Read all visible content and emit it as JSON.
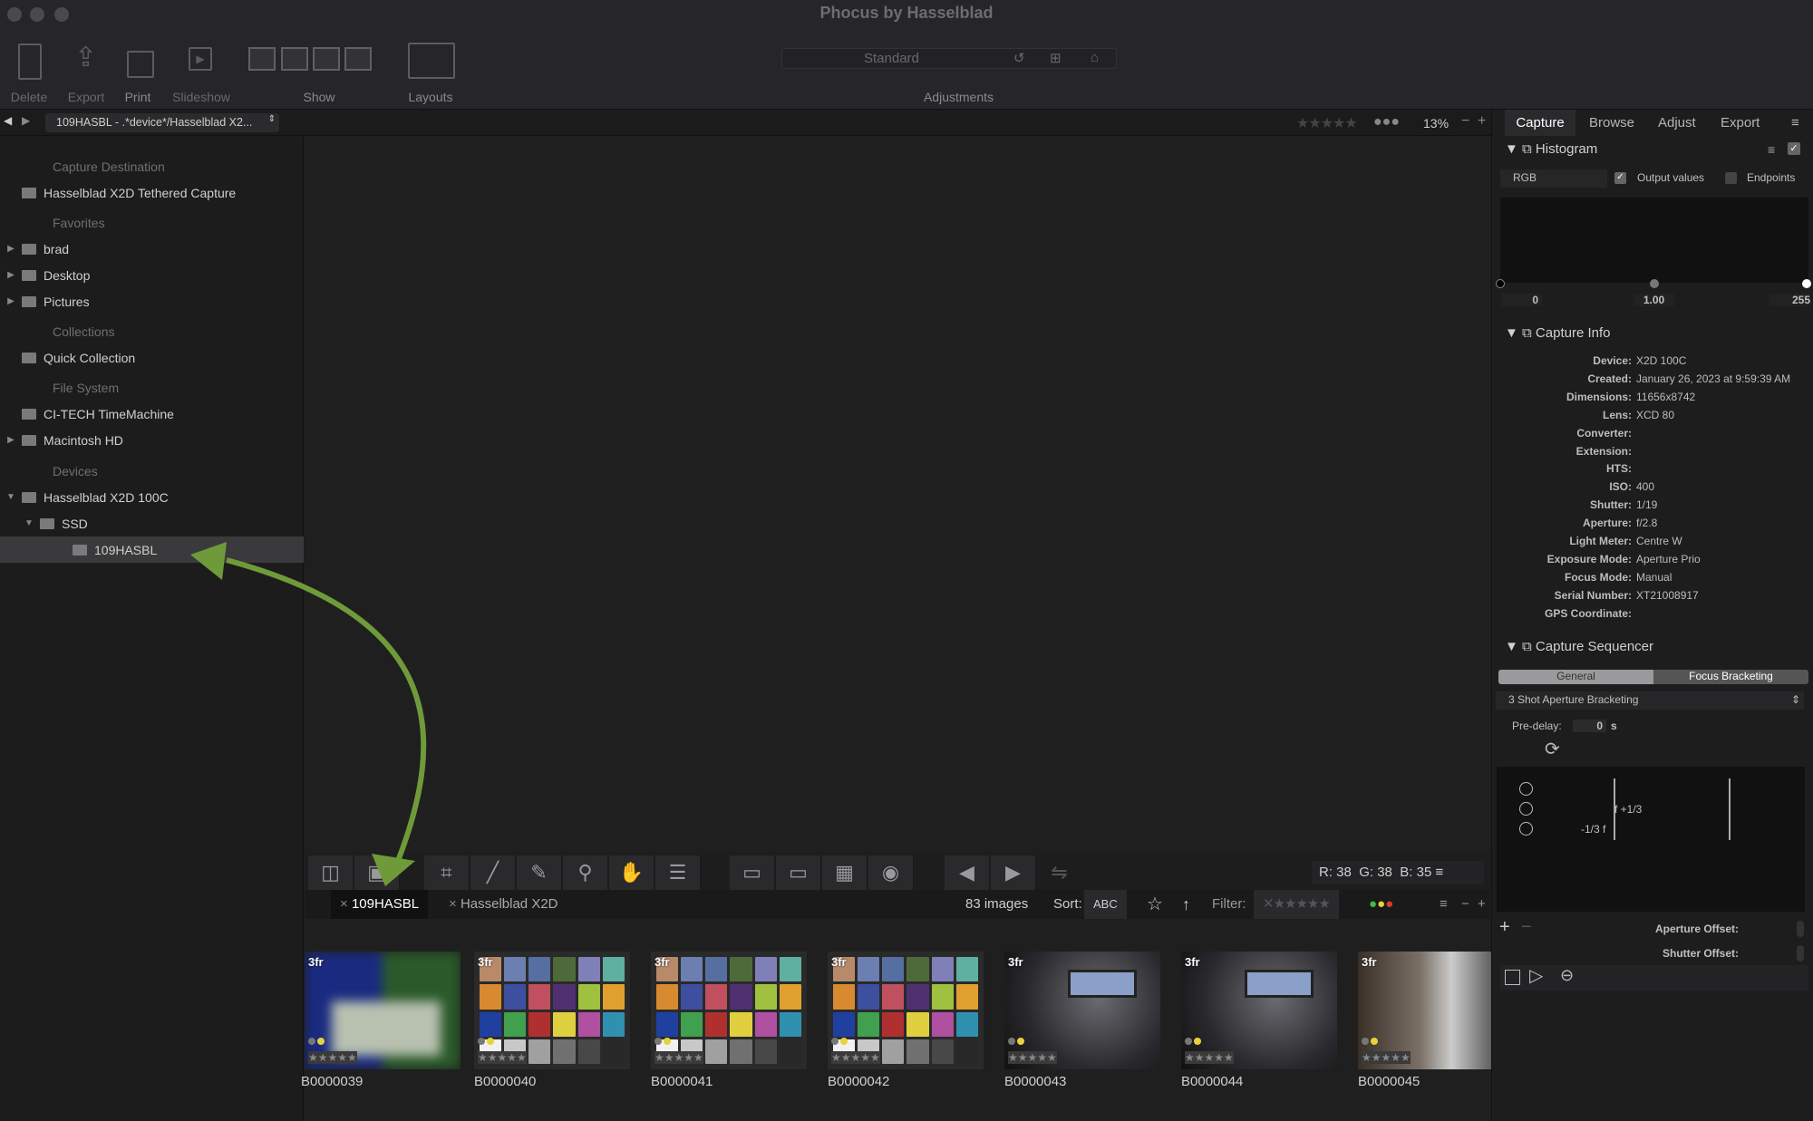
{
  "window": {
    "title": "Phocus by Hasselblad"
  },
  "toolbar": {
    "items": [
      {
        "label": "Delete",
        "icon": "trash-icon"
      },
      {
        "label": "Export",
        "icon": "export-icon"
      },
      {
        "label": "Print",
        "icon": "print-icon"
      },
      {
        "label": "Slideshow",
        "icon": "slideshow-icon"
      },
      {
        "label": "Show",
        "icon": "show-layout-icon"
      },
      {
        "label": "Layouts",
        "icon": "layouts-icon"
      }
    ],
    "preset": "Standard",
    "adjustments_label": "Adjustments"
  },
  "nav": {
    "path": "109HASBL - .*device*/Hasselblad X2...",
    "zoom": "13%",
    "tabs": [
      "Capture",
      "Browse",
      "Adjust",
      "Export"
    ],
    "active_tab": "Capture"
  },
  "sidebar": {
    "capture_destination": {
      "heading": "Capture Destination",
      "items": [
        "Hasselblad X2D Tethered Capture"
      ]
    },
    "favorites": {
      "heading": "Favorites",
      "items": [
        "brad",
        "Desktop",
        "Pictures"
      ]
    },
    "collections": {
      "heading": "Collections",
      "items": [
        "Quick Collection"
      ]
    },
    "file_system": {
      "heading": "File System",
      "items": [
        "CI-TECH TimeMachine",
        "Macintosh HD"
      ]
    },
    "devices": {
      "heading": "Devices",
      "items": [
        "Hasselblad X2D 100C",
        "SSD",
        "109HASBL"
      ],
      "selected": "109HASBL"
    }
  },
  "viewer": {
    "readout": {
      "r_label": "R:",
      "r": "38",
      "g_label": "G:",
      "g": "38",
      "b_label": "B:",
      "b": "35"
    }
  },
  "browser": {
    "tabs": [
      "109HASBL",
      "Hasselblad X2D"
    ],
    "active_tab": "109HASBL",
    "count": "83 images",
    "sort_label": "Sort:",
    "sort_value": "ABC",
    "filter_label": "Filter:",
    "filter_colors": [
      "#3fbf3f",
      "#e6d23a",
      "#e03a2f"
    ]
  },
  "thumbnails": [
    {
      "name": "B0000039",
      "badge": "3fr"
    },
    {
      "name": "B0000040",
      "badge": "3fr"
    },
    {
      "name": "B0000041",
      "badge": "3fr"
    },
    {
      "name": "B0000042",
      "badge": "3fr"
    },
    {
      "name": "B0000043",
      "badge": "3fr"
    },
    {
      "name": "B0000044",
      "badge": "3fr"
    },
    {
      "name": "B0000045",
      "badge": "3fr"
    }
  ],
  "histogram": {
    "title": "Histogram",
    "channel": "RGB",
    "output_values_label": "Output values",
    "output_values_checked": true,
    "endpoints_label": "Endpoints",
    "endpoints_checked": false,
    "black": "0",
    "gamma": "1.00",
    "white": "255"
  },
  "capture_info": {
    "title": "Capture Info",
    "fields": [
      {
        "k": "Device:",
        "v": "X2D 100C"
      },
      {
        "k": "Created:",
        "v": "January 26, 2023 at 9:59:39 AM"
      },
      {
        "k": "Dimensions:",
        "v": "11656x8742"
      },
      {
        "k": "Lens:",
        "v": "XCD 80"
      },
      {
        "k": "Converter:",
        "v": ""
      },
      {
        "k": "Extension:",
        "v": ""
      },
      {
        "k": "HTS:",
        "v": ""
      },
      {
        "k": "ISO:",
        "v": "400"
      },
      {
        "k": "Shutter:",
        "v": "1/19"
      },
      {
        "k": "Aperture:",
        "v": "f/2.8"
      },
      {
        "k": "Light Meter:",
        "v": "Centre W"
      },
      {
        "k": "Exposure Mode:",
        "v": "Aperture Prio"
      },
      {
        "k": "Focus Mode:",
        "v": "Manual"
      },
      {
        "k": "Serial Number:",
        "v": "XT21008917"
      },
      {
        "k": "GPS Coordinate:",
        "v": ""
      }
    ]
  },
  "sequencer": {
    "title": "Capture Sequencer",
    "tabs": [
      "General",
      "Focus Bracketing"
    ],
    "active_tab": "Focus Bracketing",
    "preset": "3 Shot Aperture Bracketing",
    "predelay_label": "Pre-delay:",
    "predelay": "0",
    "predelay_unit": "s",
    "plus_label": "f +1/3",
    "minus_label": "-1/3 f",
    "aperture_offset": "Aperture Offset:",
    "shutter_offset": "Shutter Offset:"
  },
  "colors": {
    "annotation_arrow": "#6f9a3a",
    "accent_selected": "#3a3a3c"
  }
}
